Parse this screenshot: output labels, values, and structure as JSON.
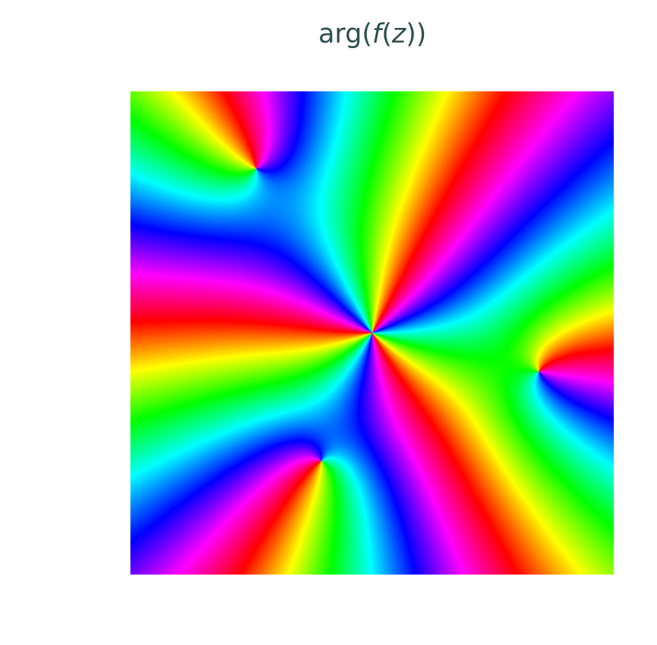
{
  "chart_data": {
    "type": "heatmap",
    "title": {
      "prefix": "arg(",
      "func": "f",
      "open": "(",
      "arg": "z",
      "close": "))"
    },
    "colormap": "hsv-phase",
    "axes_visible": false,
    "grid": false,
    "xlim": [
      -1,
      1
    ],
    "ylim": [
      -1,
      1
    ],
    "zeros": [
      {
        "re": 0.0,
        "im": 0.0,
        "order": 3
      },
      {
        "re": -0.48,
        "im": 0.68,
        "order": 1
      },
      {
        "re": 0.69,
        "im": -0.16,
        "order": 1
      },
      {
        "re": -0.21,
        "im": -0.53,
        "order": 1
      }
    ],
    "phase_offset_deg": 0
  }
}
